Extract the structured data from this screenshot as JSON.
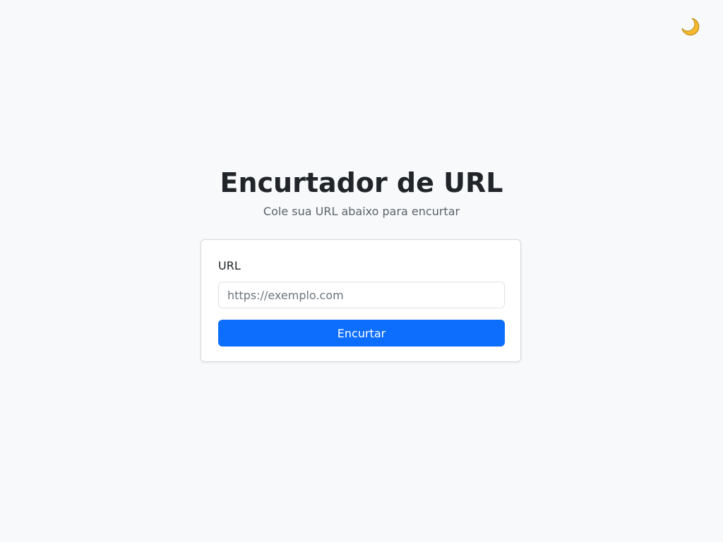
{
  "theme_toggle": {
    "icon": "moon-icon",
    "icon_color": "#f5b82e"
  },
  "header": {
    "title": "Encurtador de URL",
    "subtitle": "Cole sua URL abaixo para encurtar"
  },
  "form": {
    "url_label": "URL",
    "url_value": "",
    "url_placeholder": "https://exemplo.com",
    "submit_label": "Encurtar"
  },
  "colors": {
    "background": "#f8f9fa",
    "primary": "#0d6efd",
    "card_border": "#d6d9dc"
  }
}
